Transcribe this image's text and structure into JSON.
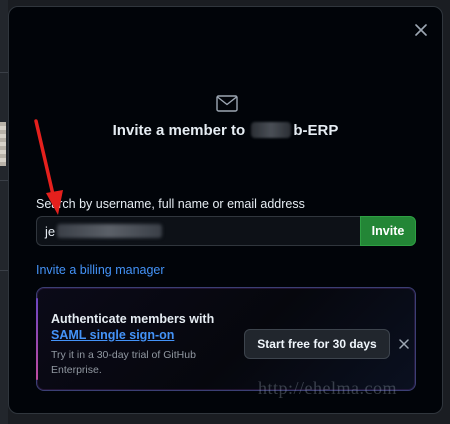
{
  "modal": {
    "title_prefix": "Invite a member to",
    "title_suffix": "b-ERP",
    "close_icon": "close-icon",
    "header_icon": "mail-icon"
  },
  "search": {
    "label": "Search by username, full name or email address",
    "value_prefix": "je",
    "invite_label": "Invite"
  },
  "billing_link": "Invite a billing manager",
  "saml": {
    "title": "Authenticate members with",
    "link": "SAML single sign-on",
    "description": "Try it in a 30-day trial of GitHub Enterprise.",
    "trial_button": "Start free for 30 days",
    "dismiss_icon": "close-icon"
  },
  "watermark": "http://ehelma.com",
  "colors": {
    "accent_green": "#238636",
    "link_blue": "#4493f8",
    "annotation_red": "#e5201d"
  }
}
